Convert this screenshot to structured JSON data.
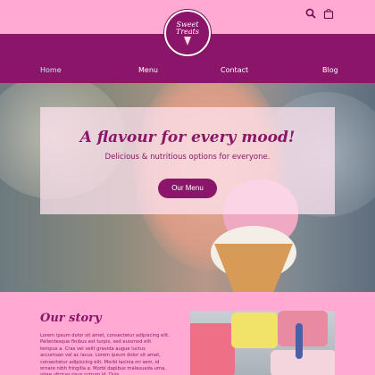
{
  "logo": {
    "line1": "Sweet",
    "line2": "Treats"
  },
  "nav": {
    "items": [
      {
        "label": "Home"
      },
      {
        "label": "Menu"
      },
      {
        "label": "Contact"
      },
      {
        "label": "Blog"
      }
    ]
  },
  "header": {
    "icons": [
      "search-icon",
      "shopping-bag-icon"
    ]
  },
  "hero": {
    "title": "A flavour for every mood!",
    "subtitle": "Delicious & nutritious options for everyone.",
    "button_label": "Our Menu"
  },
  "story": {
    "title": "Our story",
    "body": "Lorem ipsum dolor sit amet, consectetur adipiscing elit. Pellentesque finibus est turpis, sed euismod elit tempus a. Cras vel velit gravida augue luctus accumsan vel ac lacus. Lorem ipsum dolor sit amet, consectetur adipiscing elit. Morbi lacinia mi sem, id ornare nibh fringilla a. Morbi dapibus malesuada urna, vitae ultrices risus rutrum id. Duis..."
  },
  "colors": {
    "brand": "#8b1669",
    "background": "#ffa9d3",
    "nav_active": "#cde6ff"
  }
}
